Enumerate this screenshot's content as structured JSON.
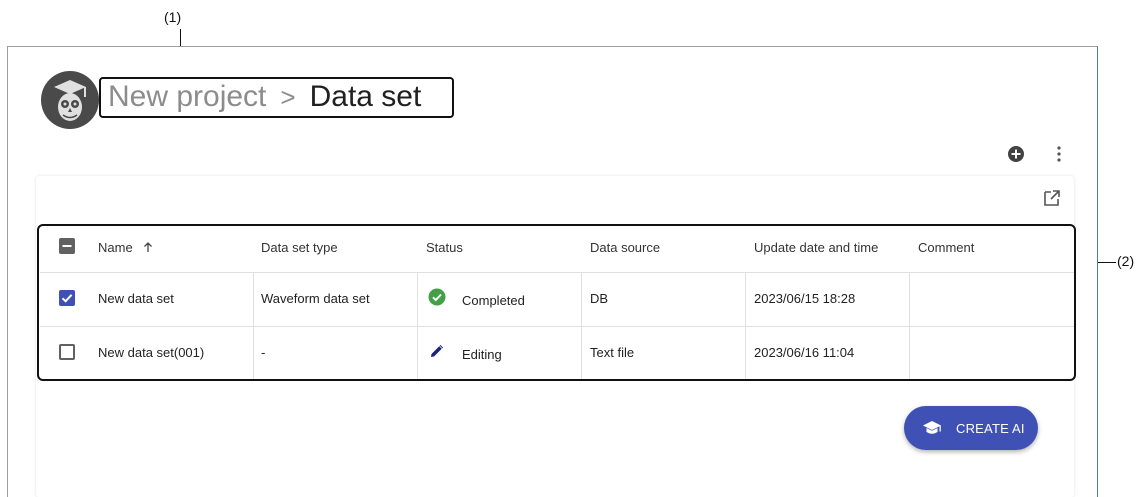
{
  "callouts": {
    "one": "(1)",
    "two": "(2)"
  },
  "header": {
    "breadcrumb": {
      "project": "New project",
      "separator": ">",
      "current": "Data set"
    }
  },
  "table": {
    "columns": [
      "Name",
      "Data set type",
      "Status",
      "Data source",
      "Update date and time",
      "Comment"
    ],
    "sort_icon": "arrow-up-icon",
    "rows": [
      {
        "checked": true,
        "name": "New data set",
        "type": "Waveform data set",
        "status": "Completed",
        "status_icon": "check-circle-icon",
        "source": "DB",
        "updated": "2023/06/15 18:28",
        "comment": ""
      },
      {
        "checked": false,
        "name": "New data set(001)",
        "type": "-",
        "status": "Editing",
        "status_icon": "pencil-icon",
        "source": "Text file",
        "updated": "2023/06/16 11:04",
        "comment": ""
      }
    ]
  },
  "fab": {
    "label": "CREATE AI",
    "icon": "graduation-cap-icon"
  },
  "colors": {
    "accent": "#3f51b5",
    "checkbox": "#3f51b5",
    "success": "#43a047",
    "edit": "#1a237e"
  }
}
